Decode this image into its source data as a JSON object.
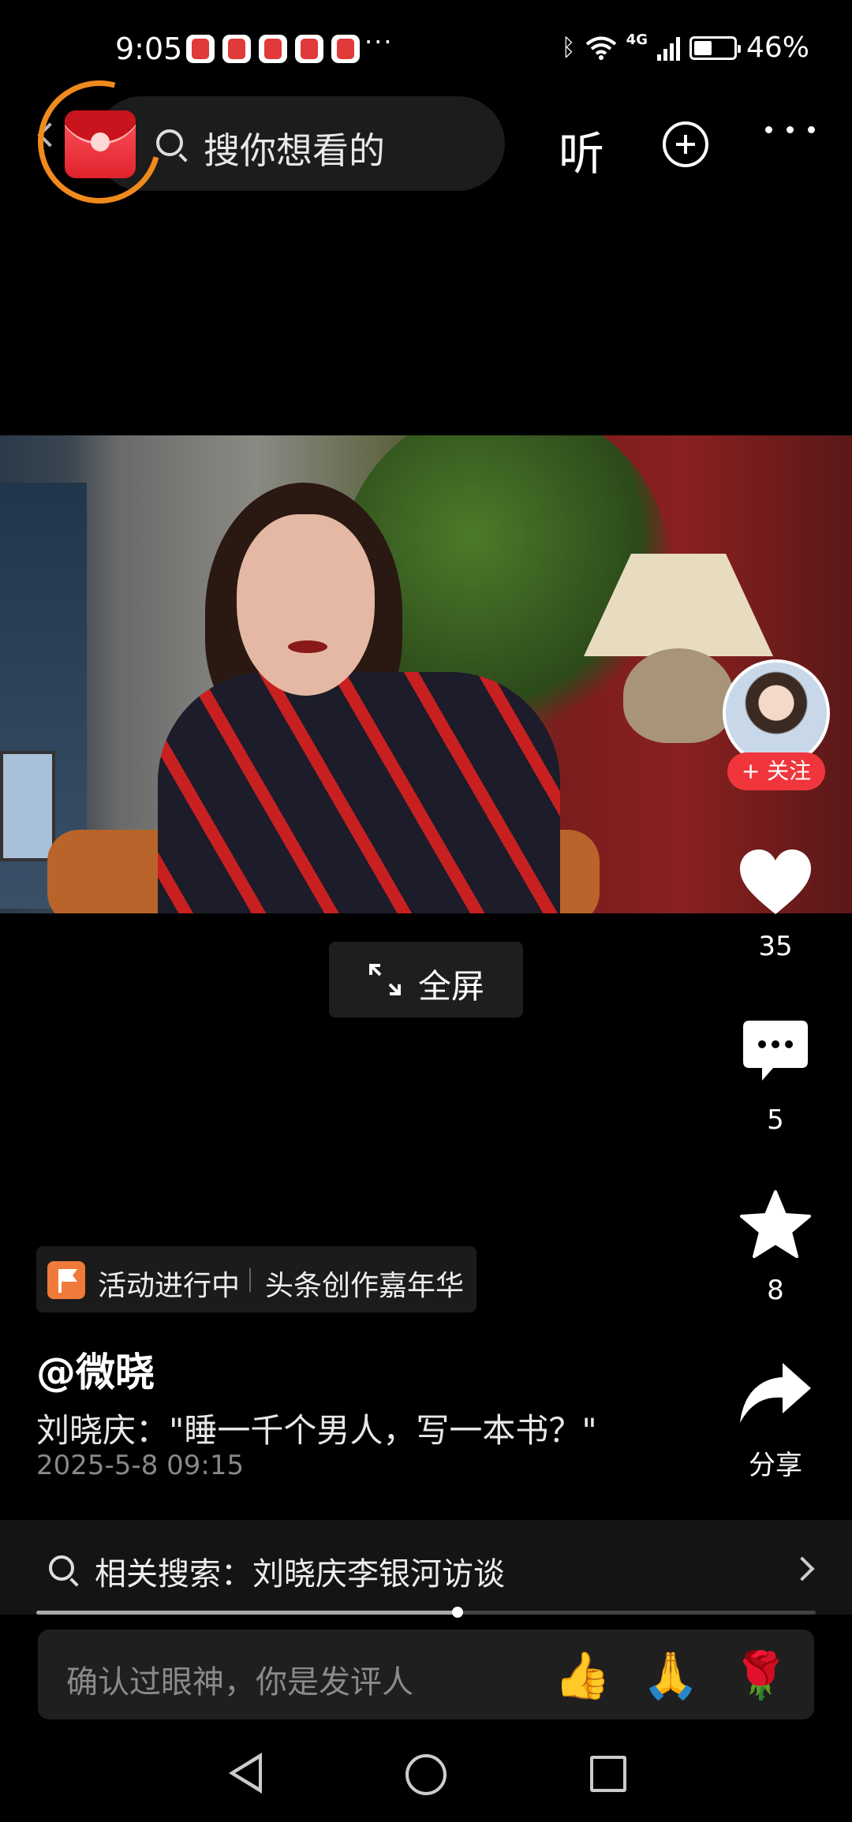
{
  "status_bar": {
    "time": "9:05",
    "more_indicator": "···",
    "network": "4G",
    "battery_percent": "46%",
    "battery_level": 0.46
  },
  "top_bar": {
    "search_placeholder": "搜你想看的",
    "listen_label": "听"
  },
  "video": {
    "fullscreen_label": "全屏",
    "progress_fraction": 0.54
  },
  "author_panel": {
    "follow_label": "+ 关注"
  },
  "actions": {
    "like_count": "35",
    "comment_count": "5",
    "favorite_count": "8",
    "share_label": "分享"
  },
  "post": {
    "activity_status": "活动进行中",
    "activity_name": "头条创作嘉年华",
    "author": "@微晓",
    "title": "刘晓庆：\"睡一千个男人，写一本书？\"",
    "date": "2025-5-8 09:15"
  },
  "related_search": {
    "text": "相关搜索：刘晓庆李银河访谈"
  },
  "comment_input": {
    "placeholder": "确认过眼神，你是发评人",
    "emojis": [
      "👍",
      "🙏",
      "🌹"
    ]
  },
  "colors": {
    "accent_red": "#f0363c",
    "ring_orange": "#f08a1c",
    "activity_orange": "#f07a3a"
  }
}
